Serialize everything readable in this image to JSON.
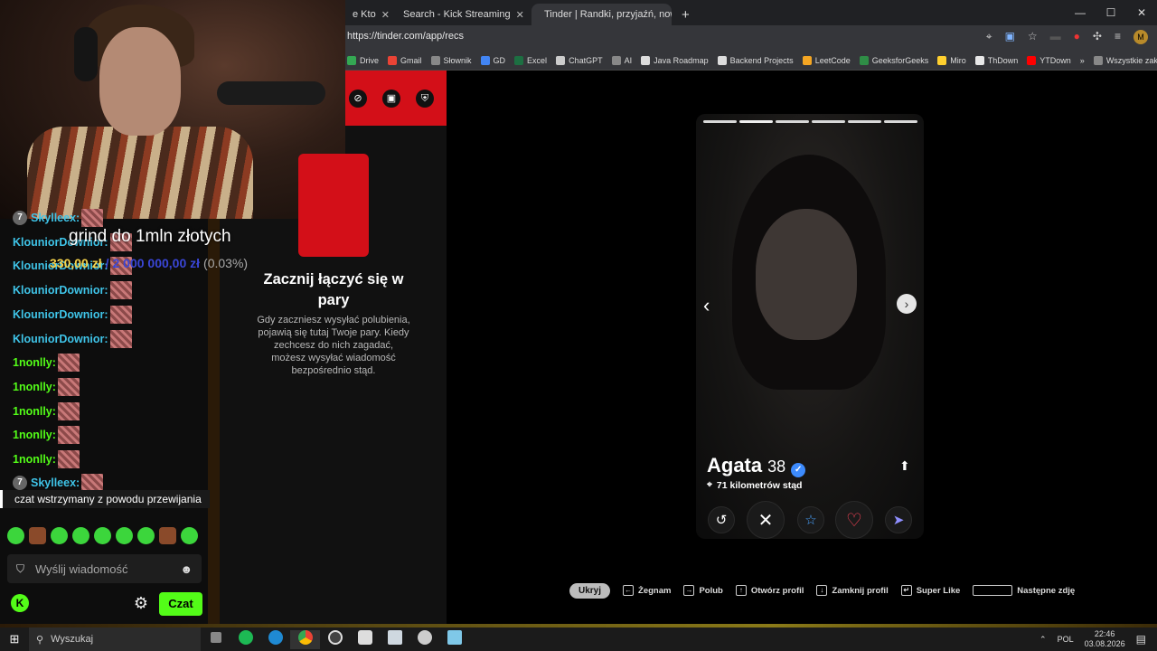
{
  "stream": {
    "goal_title": "grind do 1mln złotych",
    "goal_current": "330,00 zł",
    "goal_separator": "/",
    "goal_target": "2 000 000,00 zł",
    "goal_percent": "(0.03%)"
  },
  "chat": {
    "messages": [
      {
        "user": "Skylleex:",
        "color": "cyan",
        "badge": "7"
      },
      {
        "user": "KlouniorDownior:",
        "color": "cyan"
      },
      {
        "user": "KlouniorDownior:",
        "color": "cyan"
      },
      {
        "user": "KlouniorDownior:",
        "color": "cyan"
      },
      {
        "user": "KlouniorDownior:",
        "color": "cyan"
      },
      {
        "user": "KlouniorDownior:",
        "color": "cyan"
      },
      {
        "user": "1nonlly:",
        "color": "green"
      },
      {
        "user": "1nonlly:",
        "color": "green"
      },
      {
        "user": "1nonlly:",
        "color": "green"
      },
      {
        "user": "1nonlly:",
        "color": "green"
      },
      {
        "user": "1nonlly:",
        "color": "green"
      },
      {
        "user": "Skylleex:",
        "color": "cyan",
        "badge": "7"
      }
    ],
    "paused_notice": "czat wstrzymany z powodu przewijania",
    "input_placeholder": "Wyślij wiadomość",
    "send_label": "Czat",
    "kick_logo": "K"
  },
  "browser": {
    "tabs": [
      {
        "title": "e Kto",
        "favicon_color": "#888888"
      },
      {
        "title": "Search - Kick Streaming",
        "favicon_color": "#53fc18"
      },
      {
        "title": "Tinder | Randki, przyjaźń, nowe",
        "favicon_color": "#d30f18"
      }
    ],
    "new_tab": "+",
    "url": "https://tinder.com/app/recs",
    "bookmarks": [
      {
        "label": "Drive",
        "color": "#34a853"
      },
      {
        "label": "Gmail",
        "color": "#ea4335"
      },
      {
        "label": "Słownik",
        "color": "#888888"
      },
      {
        "label": "GD",
        "color": "#4285f4"
      },
      {
        "label": "Excel",
        "color": "#1d6f42"
      },
      {
        "label": "ChatGPT",
        "color": "#cccccc"
      },
      {
        "label": "AI",
        "color": "#888888"
      },
      {
        "label": "Java Roadmap",
        "color": "#dddddd"
      },
      {
        "label": "Backend Projects",
        "color": "#dddddd"
      },
      {
        "label": "LeetCode",
        "color": "#f5a623"
      },
      {
        "label": "GeeksforGeeks",
        "color": "#2f8d46"
      },
      {
        "label": "Miro",
        "color": "#ffd02f"
      },
      {
        "label": "ThDown",
        "color": "#e8e8e8"
      },
      {
        "label": "YTDown",
        "color": "#ff0000"
      },
      {
        "label": "»",
        "color": ""
      },
      {
        "label": "Wszystkie zakła",
        "color": "#888888"
      }
    ]
  },
  "tinder": {
    "empty_title": "Zacznij łączyć się w pary",
    "empty_body": "Gdy zaczniesz wysyłać polubienia, pojawią się tutaj Twoje pary. Kiedy zechcesz do nich zagadać, możesz wysyłać wiadomość bezpośrednio stąd.",
    "profile": {
      "name": "Agata",
      "age": "38",
      "verified": true,
      "distance": "71 kilometrów stąd",
      "photo_count": 6,
      "active_photo": 2
    },
    "actions": [
      {
        "icon": "rewind-icon",
        "glyph": "↺",
        "color": "#ffffff"
      },
      {
        "icon": "nope-icon",
        "glyph": "✕",
        "color": "#ffffff"
      },
      {
        "icon": "super-like-icon",
        "glyph": "☆",
        "color": "#4aa3ff"
      },
      {
        "icon": "like-icon",
        "glyph": "♡",
        "color": "#ff4458"
      },
      {
        "icon": "boost-icon",
        "glyph": "➤",
        "color": "#8f8fff"
      }
    ],
    "shortcuts": {
      "hide": "Ukryj",
      "items": [
        {
          "key": "←",
          "label": "Żegnam"
        },
        {
          "key": "→",
          "label": "Polub"
        },
        {
          "key": "↑",
          "label": "Otwórz profil"
        },
        {
          "key": "↓",
          "label": "Zamknij profil"
        },
        {
          "key": "↵",
          "label": "Super Like"
        }
      ],
      "space_label": "Następne zdję"
    }
  },
  "taskbar": {
    "search_placeholder": "Wyszukaj",
    "lang": "POL",
    "time": "22:46",
    "date": "03.08.2026"
  }
}
